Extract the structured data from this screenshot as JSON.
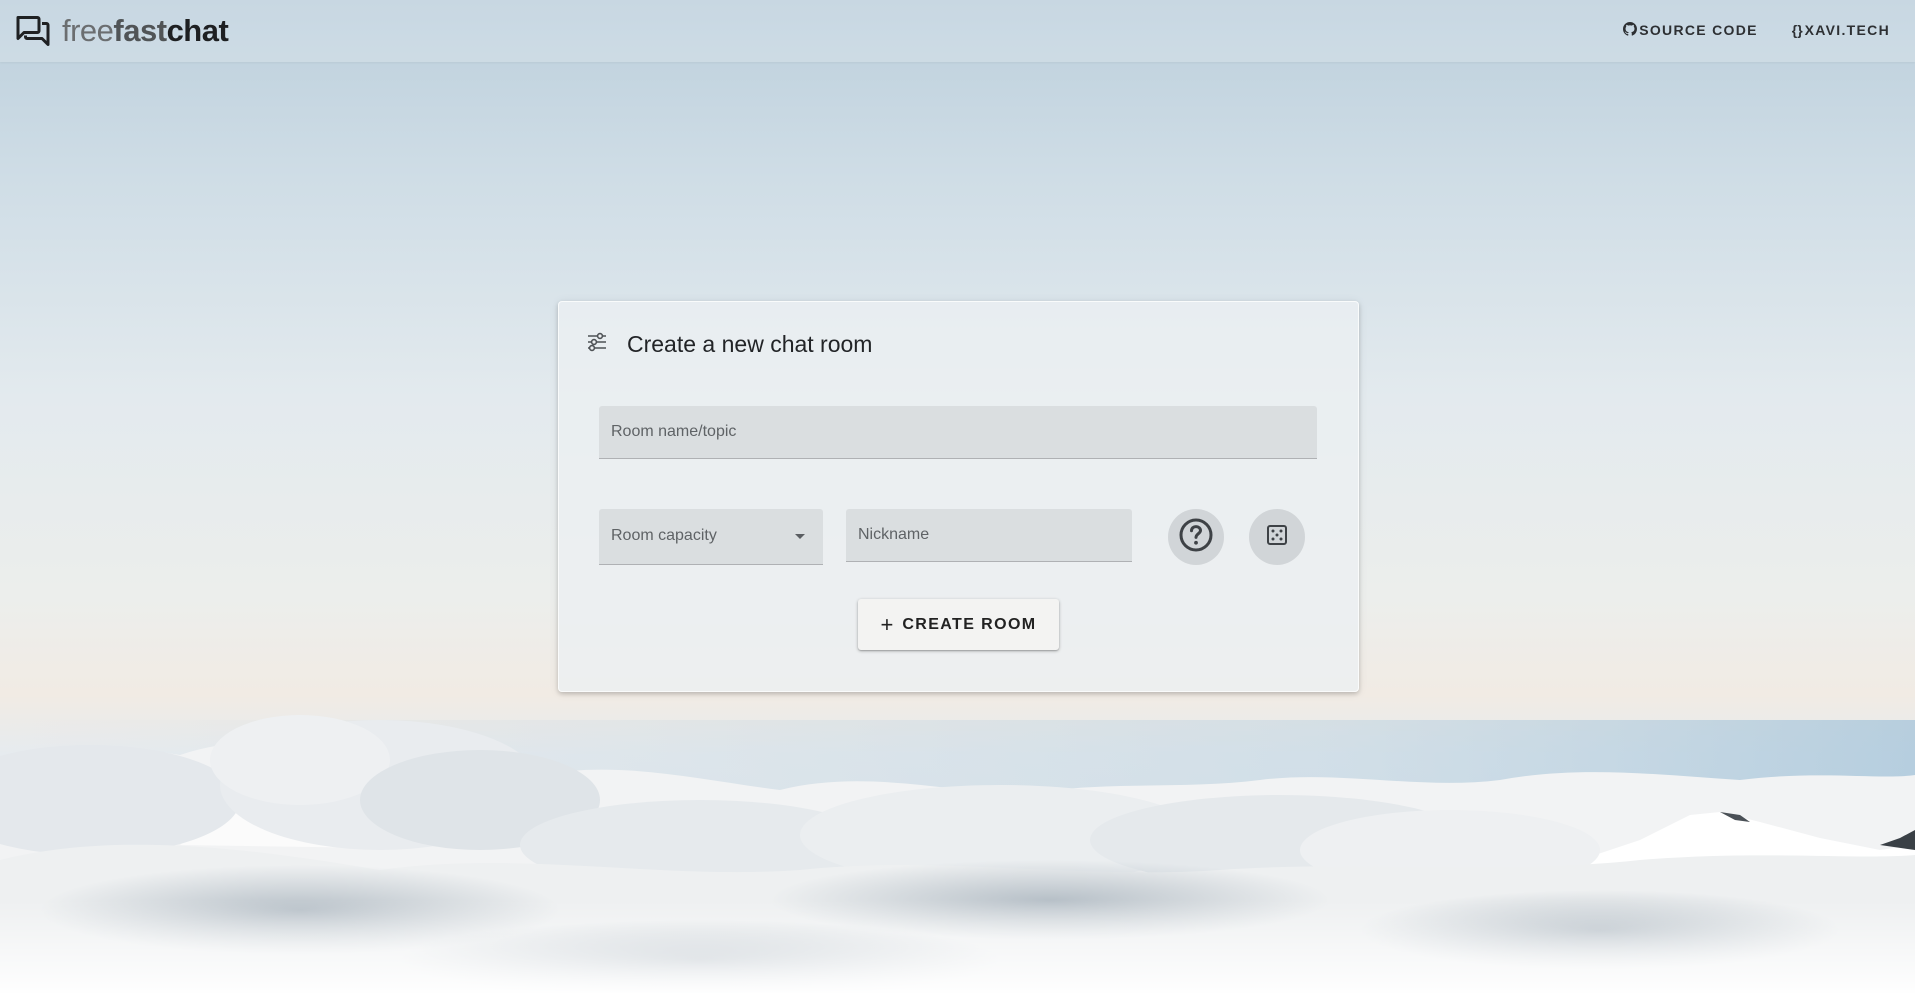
{
  "brand": {
    "part1": "free",
    "part2": "fast",
    "part3": "chat",
    "logo_icon": "chat-bubbles-icon"
  },
  "nav": {
    "source_code": {
      "label": "SOURCE CODE",
      "icon": "github-icon"
    },
    "xavi": {
      "label": "XAVI.TECH",
      "icon": "braces-icon"
    }
  },
  "card": {
    "title": "Create a new chat room",
    "title_icon": "tune-sliders-icon",
    "room_name_placeholder": "Room name/topic",
    "capacity_label": "Room capacity",
    "nickname_placeholder": "Nickname",
    "help_icon": "help-circle-icon",
    "dice_icon": "dice-icon",
    "create_button": "CREATE ROOM",
    "create_button_icon": "plus-icon"
  },
  "colors": {
    "text_dark": "#222427",
    "field_bg": "#d7dbdd"
  }
}
